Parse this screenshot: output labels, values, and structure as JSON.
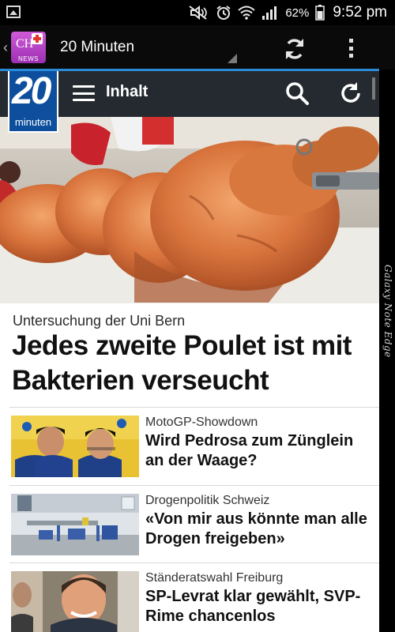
{
  "status_bar": {
    "battery_percent": "62%",
    "time": "9:52 pm",
    "icons": [
      "gallery-icon",
      "mute-icon",
      "alarm-icon",
      "wifi-icon",
      "signal-icon",
      "battery-icon"
    ]
  },
  "app_bar": {
    "title": "20 Minuten",
    "logo_text": "CH",
    "logo_subtext": "NEWS"
  },
  "site_header": {
    "logo_number": "20",
    "logo_label": "minuten",
    "menu_label": "Inhalt"
  },
  "lead_story": {
    "kicker": "Untersuchung der Uni Bern",
    "headline": "Jedes zweite Poulet ist mit Bakterien verseucht"
  },
  "articles": [
    {
      "category": "MotoGP-Showdown",
      "title": "Wird Pedrosa zum Zünglein an der Waage?"
    },
    {
      "category": "Drogenpolitik Schweiz",
      "title": "«Von mir aus könnte man alle Drogen freigeben»"
    },
    {
      "category": "Ständeratswahl Freiburg",
      "title": "SP-Levrat klar gewählt, SVP-Rime chancenlos"
    }
  ],
  "edge_label": "Galaxy Note Edge",
  "colors": {
    "accent_blue": "#2c8bd8",
    "site_header": "#252a30",
    "logo_blue": "#0d4f9c",
    "app_logo_purple": "#b33ec4"
  }
}
